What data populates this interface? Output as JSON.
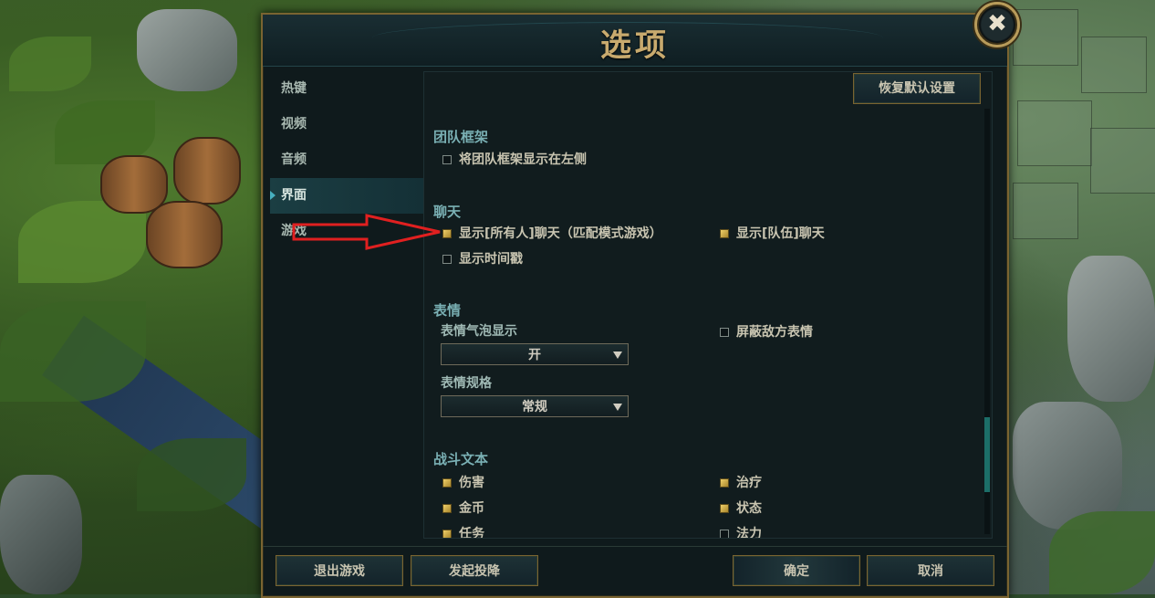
{
  "dialog": {
    "title": "选项",
    "close_glyph": "✖",
    "restore_defaults": "恢复默认设置"
  },
  "sidebar": {
    "items": [
      {
        "label": "热键"
      },
      {
        "label": "视频"
      },
      {
        "label": "音频"
      },
      {
        "label": "界面",
        "active": true
      },
      {
        "label": "游戏"
      }
    ]
  },
  "sections": {
    "team_frame": {
      "title": "团队框架",
      "options": [
        {
          "label": "将团队框架显示在左侧",
          "checked": false
        }
      ]
    },
    "chat": {
      "title": "聊天",
      "options": [
        {
          "label": "显示[所有人]聊天（匹配模式游戏）",
          "checked": true
        },
        {
          "label": "显示[队伍]聊天",
          "checked": true
        },
        {
          "label": "显示时间戳",
          "checked": false
        }
      ]
    },
    "emote": {
      "title": "表情",
      "bubble_label": "表情气泡显示",
      "bubble_value": "开",
      "size_label": "表情规格",
      "size_value": "常规",
      "hide_enemy": {
        "label": "屏蔽敌方表情",
        "checked": false
      }
    },
    "combat_text": {
      "title": "战斗文本",
      "options": [
        {
          "label": "伤害",
          "checked": true
        },
        {
          "label": "治疗",
          "checked": true
        },
        {
          "label": "金币",
          "checked": true
        },
        {
          "label": "状态",
          "checked": true
        },
        {
          "label": "任务",
          "checked": true
        },
        {
          "label": "法力",
          "checked": false
        }
      ]
    }
  },
  "footer": {
    "exit_game": "退出游戏",
    "surrender": "发起投降",
    "confirm": "确定",
    "cancel": "取消"
  },
  "colors": {
    "gold_border": "#7a6431",
    "title_gold": "#c8aa6e",
    "section_teal": "#7ab0b4",
    "annotation_arrow": "#e02020"
  }
}
